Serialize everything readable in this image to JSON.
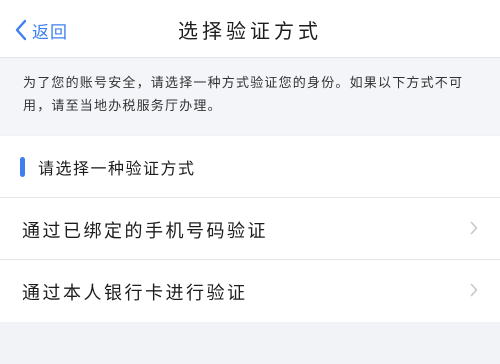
{
  "navbar": {
    "back_label": "返回",
    "title": "选择验证方式"
  },
  "notice": {
    "text": "为了您的账号安全，请选择一种方式验证您的身份。如果以下方式不可用，请至当地办税服务厅办理。"
  },
  "section": {
    "title": "请选择一种验证方式"
  },
  "options": [
    {
      "label": "通过已绑定的手机号码验证"
    },
    {
      "label": "通过本人银行卡进行验证"
    }
  ],
  "colors": {
    "accent": "#3d7ff0",
    "background": "#f2f3f7"
  },
  "icons": {
    "back": "chevron-left-icon",
    "option_arrow": "chevron-right-icon"
  }
}
